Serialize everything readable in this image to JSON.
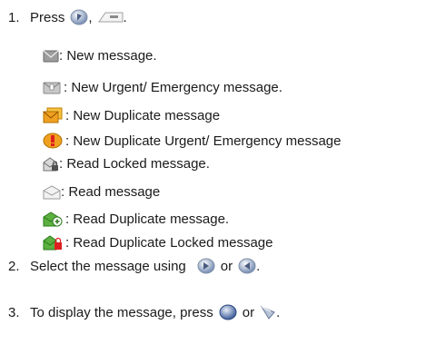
{
  "steps": [
    {
      "number": "1.",
      "text_before": "Press",
      "separator": ",",
      "text_after": "."
    },
    {
      "number": "2.",
      "text_before": "Select the message using",
      "conjunction": "or",
      "text_after": "."
    },
    {
      "number": "3.",
      "text_before": "To display the message, press",
      "conjunction": "or",
      "text_after": "."
    }
  ],
  "legend": [
    {
      "icon": "new-message-icon",
      "text": ": New message."
    },
    {
      "icon": "new-urgent-message-icon",
      "text": ": New Urgent/ Emergency message."
    },
    {
      "icon": "new-duplicate-message-icon",
      "text": ": New Duplicate message"
    },
    {
      "icon": "new-duplicate-urgent-message-icon",
      "text": ": New Duplicate Urgent/ Emergency message"
    },
    {
      "icon": "read-locked-message-icon",
      "text": ": Read Locked message."
    },
    {
      "icon": "read-message-icon",
      "text": ": Read message"
    },
    {
      "icon": "read-duplicate-message-icon",
      "text": ": Read Duplicate message."
    },
    {
      "icon": "read-duplicate-locked-message-icon",
      "text": ": Read Duplicate Locked message"
    }
  ],
  "colors": {
    "text": "#1a1a1a",
    "orange": "#f0a020",
    "red": "#e02020",
    "green": "#3a9a2a",
    "grey": "#b8b8b8"
  }
}
